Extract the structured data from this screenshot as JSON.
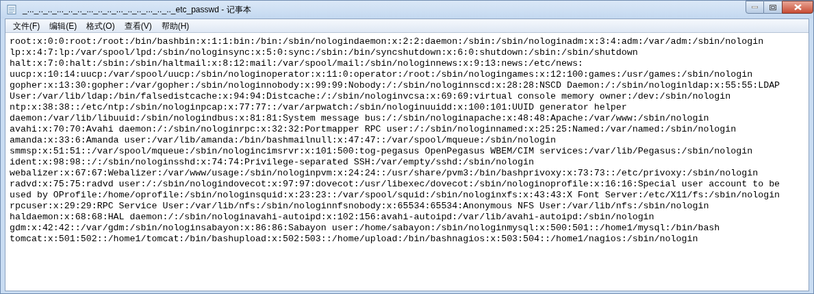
{
  "window": {
    "title": "_..._.._.._..._.._.._..._.._.._..._.._.._..._.._.._etc_passwd - 记事本"
  },
  "menu": [
    "文件(F)",
    "编辑(E)",
    "格式(O)",
    "查看(V)",
    "帮助(H)"
  ],
  "lines": [
    "root:x:0:0:root:/root:/bin/bashbin:x:1:1:bin:/bin:/sbin/nologindaemon:x:2:2:daemon:/sbin:/sbin/nologinadm:x:3:4:adm:/var/adm:/sbin/nologin",
    "lp:x:4:7:lp:/var/spool/lpd:/sbin/nologinsync:x:5:0:sync:/sbin:/bin/syncshutdown:x:6:0:shutdown:/sbin:/sbin/shutdown",
    "halt:x:7:0:halt:/sbin:/sbin/haltmail:x:8:12:mail:/var/spool/mail:/sbin/nologinnews:x:9:13:news:/etc/news:",
    "uucp:x:10:14:uucp:/var/spool/uucp:/sbin/nologinoperator:x:11:0:operator:/root:/sbin/nologingames:x:12:100:games:/usr/games:/sbin/nologin",
    "gopher:x:13:30:gopher:/var/gopher:/sbin/nologinnobody:x:99:99:Nobody:/:/sbin/nologinnscd:x:28:28:NSCD Daemon:/:/sbin/nologinldap:x:55:55:LDAP",
    "User:/var/lib/ldap:/bin/falsedistcache:x:94:94:Distcache:/:/sbin/nologinvcsa:x:69:69:virtual console memory owner:/dev:/sbin/nologin",
    "ntp:x:38:38::/etc/ntp:/sbin/nologinpcap:x:77:77::/var/arpwatch:/sbin/nologinuuidd:x:100:101:UUID generator helper",
    "daemon:/var/lib/libuuid:/sbin/nologindbus:x:81:81:System message bus:/:/sbin/nologinapache:x:48:48:Apache:/var/www:/sbin/nologin",
    "avahi:x:70:70:Avahi daemon:/:/sbin/nologinrpc:x:32:32:Portmapper RPC user:/:/sbin/nologinnamed:x:25:25:Named:/var/named:/sbin/nologin",
    "amanda:x:33:6:Amanda user:/var/lib/amanda:/bin/bashmailnull:x:47:47::/var/spool/mqueue:/sbin/nologin",
    "smmsp:x:51:51::/var/spool/mqueue:/sbin/nologincimsrvr:x:101:500:tog-pegasus OpenPegasus WBEM/CIM services:/var/lib/Pegasus:/sbin/nologin",
    "ident:x:98:98::/:/sbin/nologinsshd:x:74:74:Privilege-separated SSH:/var/empty/sshd:/sbin/nologin",
    "webalizer:x:67:67:Webalizer:/var/www/usage:/sbin/nologinpvm:x:24:24::/usr/share/pvm3:/bin/bashprivoxy:x:73:73::/etc/privoxy:/sbin/nologin",
    "radvd:x:75:75:radvd user:/:/sbin/nologindovecot:x:97:97:dovecot:/usr/libexec/dovecot:/sbin/nologinoprofile:x:16:16:Special user account to be",
    "used by OProfile:/home/oprofile:/sbin/nologinsquid:x:23:23::/var/spool/squid:/sbin/nologinxfs:x:43:43:X Font Server:/etc/X11/fs:/sbin/nologin",
    "rpcuser:x:29:29:RPC Service User:/var/lib/nfs:/sbin/nologinnfsnobody:x:65534:65534:Anonymous NFS User:/var/lib/nfs:/sbin/nologin",
    "haldaemon:x:68:68:HAL daemon:/:/sbin/nologinavahi-autoipd:x:102:156:avahi-autoipd:/var/lib/avahi-autoipd:/sbin/nologin",
    "gdm:x:42:42::/var/gdm:/sbin/nologinsabayon:x:86:86:Sabayon user:/home/sabayon:/sbin/nologinmysql:x:500:501::/home1/mysql:/bin/bash",
    "tomcat:x:501:502::/home1/tomcat:/bin/bashupload:x:502:503::/home/upload:/bin/bashnagios:x:503:504::/home1/nagios:/sbin/nologin"
  ]
}
